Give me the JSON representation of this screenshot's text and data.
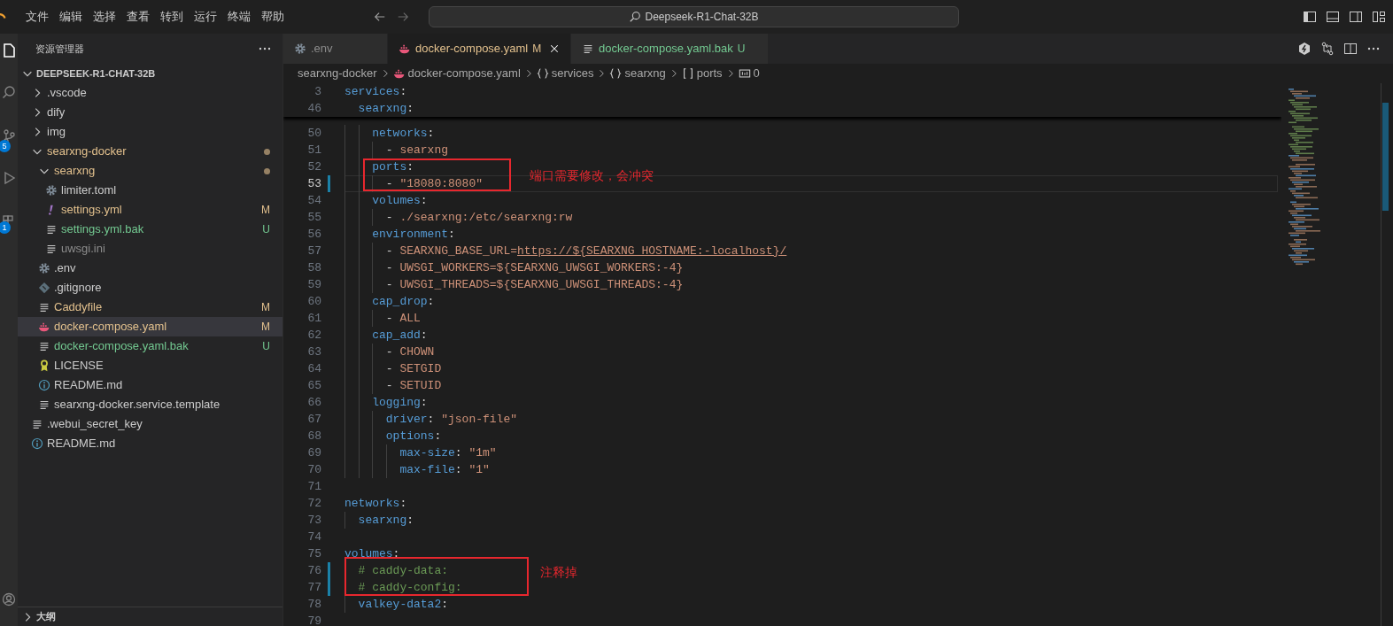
{
  "title_bar": {
    "menu": [
      "文件",
      "编辑",
      "选择",
      "查看",
      "转到",
      "运行",
      "终端",
      "帮助"
    ],
    "search": "Deepseek-R1-Chat-32B"
  },
  "activity_bar": [
    {
      "kind": "files",
      "selected": true
    },
    {
      "kind": "search",
      "selected": false
    },
    {
      "kind": "source-control",
      "selected": false,
      "badge": "5"
    },
    {
      "kind": "run",
      "selected": false
    },
    {
      "kind": "extensions",
      "selected": false,
      "badge": "1"
    },
    {
      "kind": "account",
      "selected": false
    }
  ],
  "sidebar": {
    "title": "资源管理器",
    "root": {
      "label": "DEEPSEEK-R1-CHAT-32B",
      "expanded": true
    },
    "items": [
      {
        "label": ".vscode",
        "kind": "folder",
        "expanded": false,
        "selected": false
      },
      {
        "label": "dify",
        "kind": "folder",
        "expanded": false,
        "selected": false
      },
      {
        "label": "img",
        "kind": "folder",
        "expanded": false,
        "selected": false
      },
      {
        "label": "searxng-docker",
        "kind": "folder",
        "expanded": true,
        "selected": false,
        "color": "#e2c08d",
        "children": [
          {
            "label": "searxng",
            "kind": "folder",
            "expanded": true,
            "selected": false,
            "color": "#e2c08d",
            "children": [
              {
                "label": "limiter.toml",
                "kind": "gear",
                "selected": false
              },
              {
                "label": "settings.yml",
                "kind": "yaml",
                "selected": false,
                "color": "#e2c08d",
                "badge": "M"
              },
              {
                "label": "settings.yml.bak",
                "kind": "lines",
                "selected": false,
                "color": "#73c991",
                "badge": "U"
              },
              {
                "label": "uwsgi.ini",
                "kind": "lines",
                "selected": false,
                "color": "#8c8c8c"
              }
            ]
          },
          {
            "label": ".env",
            "kind": "gear",
            "selected": false
          },
          {
            "label": ".gitignore",
            "kind": "git",
            "selected": false
          },
          {
            "label": "Caddyfile",
            "kind": "lines",
            "selected": false,
            "color": "#e2c08d",
            "badge": "M"
          },
          {
            "label": "docker-compose.yaml",
            "kind": "docker",
            "selected": true,
            "color": "#e2c08d",
            "badge": "M"
          },
          {
            "label": "docker-compose.yaml.bak",
            "kind": "lines",
            "selected": false,
            "color": "#73c991",
            "badge": "U"
          },
          {
            "label": "LICENSE",
            "kind": "license",
            "selected": false
          },
          {
            "label": "README.md",
            "kind": "info",
            "selected": false
          },
          {
            "label": "searxng-docker.service.template",
            "kind": "lines",
            "selected": false
          }
        ]
      },
      {
        "label": ".webui_secret_key",
        "kind": "lines",
        "selected": false
      },
      {
        "label": "README.md",
        "kind": "info",
        "selected": false
      }
    ],
    "outline": {
      "label": "大纲",
      "expanded": false
    }
  },
  "tabs": [
    {
      "label": ".env",
      "kind": "gear",
      "selected": false
    },
    {
      "label": "docker-compose.yaml",
      "kind": "docker",
      "selected": true,
      "color": "#e2c08d",
      "badge": "M"
    },
    {
      "label": "docker-compose.yaml.bak",
      "kind": "lines",
      "selected": false,
      "color": "#73c991",
      "badge": "U"
    }
  ],
  "breadcrumbs": [
    {
      "label": "searxng-docker",
      "kind": "folder"
    },
    {
      "label": "docker-compose.yaml",
      "kind": "docker"
    },
    {
      "label": "services",
      "kind": "object"
    },
    {
      "label": "searxng",
      "kind": "object"
    },
    {
      "label": "ports",
      "kind": "array"
    },
    {
      "label": "0",
      "kind": "number"
    }
  ],
  "editor": {
    "sticky": [
      {
        "n": "3",
        "tokens": [
          {
            "kind": "key",
            "text": "services"
          },
          {
            "kind": "punct",
            "text": ":"
          }
        ]
      },
      {
        "n": "46",
        "tokens": [
          {
            "kind": "key",
            "text": "  searxng"
          },
          {
            "kind": "punct",
            "text": ":"
          }
        ]
      }
    ],
    "lines": [
      {
        "n": "50",
        "changed": false,
        "current": false,
        "tokens": [
          {
            "kind": "key",
            "text": "    networks"
          },
          {
            "kind": "punct",
            "text": ":"
          }
        ]
      },
      {
        "n": "51",
        "changed": false,
        "current": false,
        "tokens": [
          {
            "kind": "punct",
            "text": "      - "
          },
          {
            "kind": "str",
            "text": "searxng"
          }
        ]
      },
      {
        "n": "52",
        "changed": false,
        "current": false,
        "tokens": [
          {
            "kind": "key",
            "text": "    ports"
          },
          {
            "kind": "punct",
            "text": ":"
          }
        ]
      },
      {
        "n": "53",
        "changed": true,
        "current": true,
        "tokens": [
          {
            "kind": "punct",
            "text": "      - "
          },
          {
            "kind": "str",
            "text": "\"18080:8080\""
          }
        ]
      },
      {
        "n": "54",
        "changed": false,
        "current": false,
        "tokens": [
          {
            "kind": "key",
            "text": "    volumes"
          },
          {
            "kind": "punct",
            "text": ":"
          }
        ]
      },
      {
        "n": "55",
        "changed": false,
        "current": false,
        "tokens": [
          {
            "kind": "punct",
            "text": "      - "
          },
          {
            "kind": "str",
            "text": "./searxng:/etc/searxng:rw"
          }
        ]
      },
      {
        "n": "56",
        "changed": false,
        "current": false,
        "tokens": [
          {
            "kind": "key",
            "text": "    environment"
          },
          {
            "kind": "punct",
            "text": ":"
          }
        ]
      },
      {
        "n": "57",
        "changed": false,
        "current": false,
        "tokens": [
          {
            "kind": "punct",
            "text": "      - "
          },
          {
            "kind": "str",
            "text": "SEARXNG_BASE_URL="
          },
          {
            "kind": "link",
            "text": "https://${SEARXNG_HOSTNAME:-localhost}/"
          }
        ]
      },
      {
        "n": "58",
        "changed": false,
        "current": false,
        "tokens": [
          {
            "kind": "punct",
            "text": "      - "
          },
          {
            "kind": "str",
            "text": "UWSGI_WORKERS=${SEARXNG_UWSGI_WORKERS:-4}"
          }
        ]
      },
      {
        "n": "59",
        "changed": false,
        "current": false,
        "tokens": [
          {
            "kind": "punct",
            "text": "      - "
          },
          {
            "kind": "str",
            "text": "UWSGI_THREADS=${SEARXNG_UWSGI_THREADS:-4}"
          }
        ]
      },
      {
        "n": "60",
        "changed": false,
        "current": false,
        "tokens": [
          {
            "kind": "key",
            "text": "    cap_drop"
          },
          {
            "kind": "punct",
            "text": ":"
          }
        ]
      },
      {
        "n": "61",
        "changed": false,
        "current": false,
        "tokens": [
          {
            "kind": "punct",
            "text": "      - "
          },
          {
            "kind": "str",
            "text": "ALL"
          }
        ]
      },
      {
        "n": "62",
        "changed": false,
        "current": false,
        "tokens": [
          {
            "kind": "key",
            "text": "    cap_add"
          },
          {
            "kind": "punct",
            "text": ":"
          }
        ]
      },
      {
        "n": "63",
        "changed": false,
        "current": false,
        "tokens": [
          {
            "kind": "punct",
            "text": "      - "
          },
          {
            "kind": "str",
            "text": "CHOWN"
          }
        ]
      },
      {
        "n": "64",
        "changed": false,
        "current": false,
        "tokens": [
          {
            "kind": "punct",
            "text": "      - "
          },
          {
            "kind": "str",
            "text": "SETGID"
          }
        ]
      },
      {
        "n": "65",
        "changed": false,
        "current": false,
        "tokens": [
          {
            "kind": "punct",
            "text": "      - "
          },
          {
            "kind": "str",
            "text": "SETUID"
          }
        ]
      },
      {
        "n": "66",
        "changed": false,
        "current": false,
        "tokens": [
          {
            "kind": "key",
            "text": "    logging"
          },
          {
            "kind": "punct",
            "text": ":"
          }
        ]
      },
      {
        "n": "67",
        "changed": false,
        "current": false,
        "tokens": [
          {
            "kind": "key",
            "text": "      driver"
          },
          {
            "kind": "punct",
            "text": ": "
          },
          {
            "kind": "str",
            "text": "\"json-file\""
          }
        ]
      },
      {
        "n": "68",
        "changed": false,
        "current": false,
        "tokens": [
          {
            "kind": "key",
            "text": "      options"
          },
          {
            "kind": "punct",
            "text": ":"
          }
        ]
      },
      {
        "n": "69",
        "changed": false,
        "current": false,
        "tokens": [
          {
            "kind": "key",
            "text": "        max-size"
          },
          {
            "kind": "punct",
            "text": ": "
          },
          {
            "kind": "str",
            "text": "\"1m\""
          }
        ]
      },
      {
        "n": "70",
        "changed": false,
        "current": false,
        "tokens": [
          {
            "kind": "key",
            "text": "        max-file"
          },
          {
            "kind": "punct",
            "text": ": "
          },
          {
            "kind": "str",
            "text": "\"1\""
          }
        ]
      },
      {
        "n": "71",
        "changed": false,
        "current": false
      },
      {
        "n": "72",
        "changed": false,
        "current": false,
        "tokens": [
          {
            "kind": "key",
            "text": "networks"
          },
          {
            "kind": "punct",
            "text": ":"
          }
        ]
      },
      {
        "n": "73",
        "changed": false,
        "current": false,
        "tokens": [
          {
            "kind": "key",
            "text": "  searxng"
          },
          {
            "kind": "punct",
            "text": ":"
          }
        ]
      },
      {
        "n": "74",
        "changed": false,
        "current": false
      },
      {
        "n": "75",
        "changed": false,
        "current": false,
        "tokens": [
          {
            "kind": "key",
            "text": "volumes"
          },
          {
            "kind": "punct",
            "text": ":"
          }
        ]
      },
      {
        "n": "76",
        "changed": true,
        "current": false,
        "tokens": [
          {
            "kind": "comment",
            "text": "  # caddy-data:"
          }
        ]
      },
      {
        "n": "77",
        "changed": true,
        "current": false,
        "tokens": [
          {
            "kind": "comment",
            "text": "  # caddy-config:"
          }
        ]
      },
      {
        "n": "78",
        "changed": false,
        "current": false,
        "tokens": [
          {
            "kind": "key",
            "text": "  valkey-data2"
          },
          {
            "kind": "punct",
            "text": ":"
          }
        ]
      },
      {
        "n": "79",
        "changed": false,
        "current": false
      }
    ],
    "annotations": [
      {
        "text": "端口需要修改，会冲突"
      },
      {
        "text": "注释掉"
      }
    ]
  }
}
